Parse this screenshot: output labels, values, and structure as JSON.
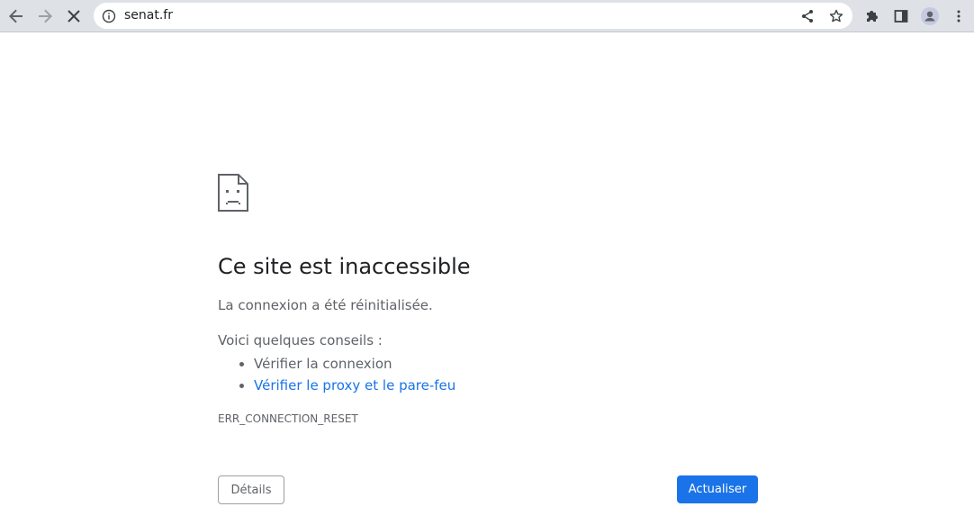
{
  "browser": {
    "url": "senat.fr",
    "icons": {
      "back": "arrow-left-icon",
      "forward": "arrow-right-icon",
      "stop": "close-icon",
      "site_info": "info-icon",
      "share": "share-icon",
      "bookmark": "star-icon",
      "extensions": "puzzle-icon",
      "side_panel": "side-panel-icon",
      "profile": "avatar-icon",
      "menu": "kebab-menu-icon"
    }
  },
  "error_page": {
    "icon": "sad-page-icon",
    "title": "Ce site est inaccessible",
    "description": "La connexion a été réinitialisée.",
    "tips_heading": "Voici quelques conseils :",
    "tips": [
      {
        "label": "Vérifier la connexion",
        "is_link": false
      },
      {
        "label": "Vérifier le proxy et le pare-feu",
        "is_link": true
      }
    ],
    "error_code": "ERR_CONNECTION_RESET",
    "details_button": "Détails",
    "reload_button": "Actualiser"
  },
  "colors": {
    "toolbar_bg": "#dee1e6",
    "link": "#1a73e8",
    "primary_button": "#1a73e8",
    "text_primary": "#202124",
    "text_secondary": "#5f6368"
  }
}
